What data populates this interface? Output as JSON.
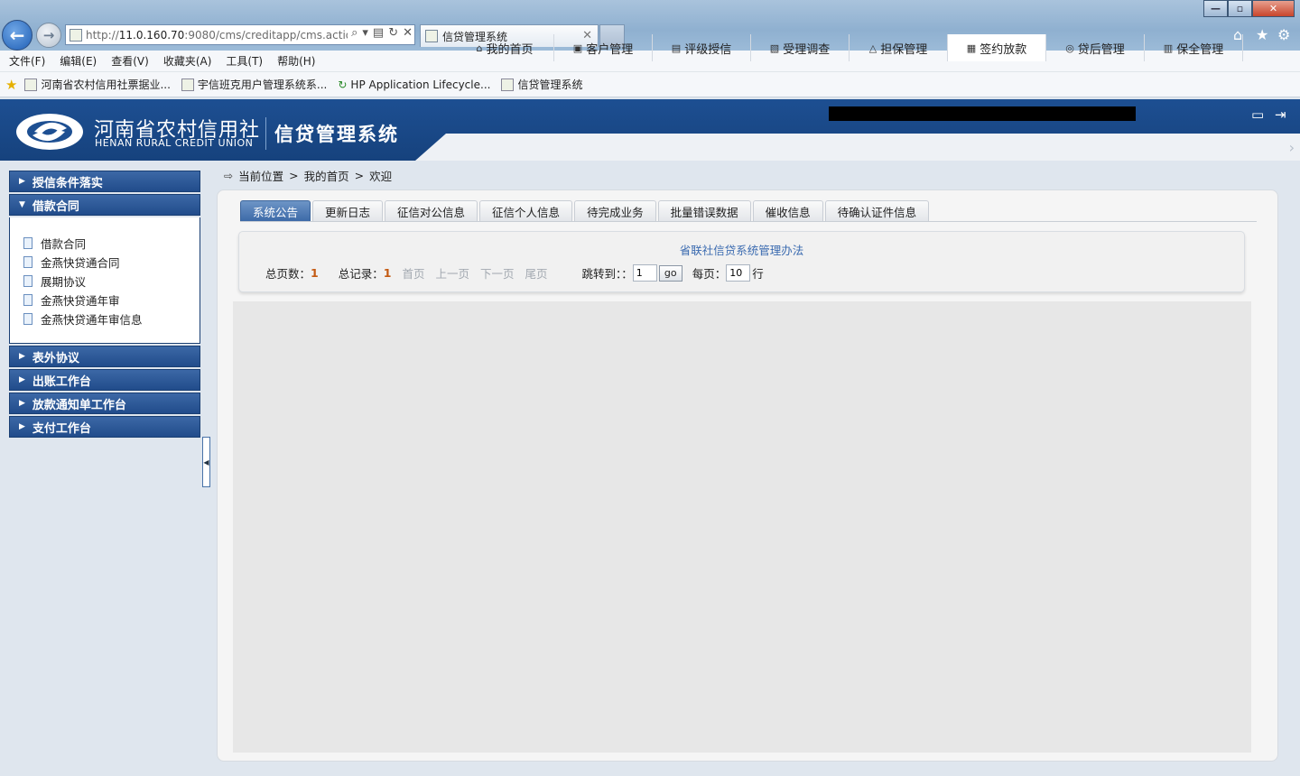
{
  "browser": {
    "url_prefix": "http://",
    "url_host": "11.0.160.70",
    "url_rest": ":9080/cms/creditapp/cms.actio",
    "tab_title": "信贷管理系统",
    "menu": [
      "文件(F)",
      "编辑(E)",
      "查看(V)",
      "收藏夹(A)",
      "工具(T)",
      "帮助(H)"
    ],
    "favorites": [
      "河南省农村信用社票据业...",
      "宇信班克用户管理系统系...",
      "HP Application Lifecycle...",
      "信贷管理系统"
    ]
  },
  "header": {
    "logo_cn": "河南省农村信用社",
    "logo_en": "HENAN RURAL CREDIT UNION",
    "system_title": "信贷管理系统",
    "nav": [
      {
        "label": "我的首页",
        "icon": "home-icon",
        "glyph": "⌂"
      },
      {
        "label": "客户管理",
        "icon": "customer-icon",
        "glyph": "▣"
      },
      {
        "label": "评级授信",
        "icon": "rating-icon",
        "glyph": "▤"
      },
      {
        "label": "受理调查",
        "icon": "survey-icon",
        "glyph": "▧"
      },
      {
        "label": "担保管理",
        "icon": "guarantee-icon",
        "glyph": "△"
      },
      {
        "label": "签约放款",
        "icon": "contract-icon",
        "glyph": "▦"
      },
      {
        "label": "贷后管理",
        "icon": "postloan-icon",
        "glyph": "◎"
      },
      {
        "label": "保全管理",
        "icon": "preserve-icon",
        "glyph": "▥"
      }
    ],
    "active_nav": "签约放款"
  },
  "sidebar": {
    "sections": [
      {
        "label": "授信条件落实",
        "expanded": false
      },
      {
        "label": "借款合同",
        "expanded": true,
        "items": [
          "借款合同",
          "金燕快贷通合同",
          "展期协议",
          "金燕快贷通年审",
          "金燕快贷通年审信息"
        ]
      },
      {
        "label": "表外协议",
        "expanded": false
      },
      {
        "label": "出账工作台",
        "expanded": false
      },
      {
        "label": "放款通知单工作台",
        "expanded": false
      },
      {
        "label": "支付工作台",
        "expanded": false
      }
    ]
  },
  "breadcrumb": {
    "current": "当前位置",
    "sep": ">",
    "home": "我的首页",
    "page": "欢迎"
  },
  "tabs": [
    "系统公告",
    "更新日志",
    "征信对公信息",
    "征信个人信息",
    "待完成业务",
    "批量错误数据",
    "催收信息",
    "待确认证件信息"
  ],
  "active_tab": "系统公告",
  "notice": {
    "title": "省联社信贷系统管理办法",
    "total_pages_label": "总页数：",
    "total_pages": "1",
    "total_records_label": "总记录：",
    "total_records": "1",
    "first": "首页",
    "prev": "上一页",
    "next": "下一页",
    "last": "尾页",
    "jump_label": "跳转到：：",
    "jump_value": "1",
    "go": "go",
    "per_page_label": "每页：",
    "per_page_value": "10",
    "per_page_unit": "行"
  }
}
